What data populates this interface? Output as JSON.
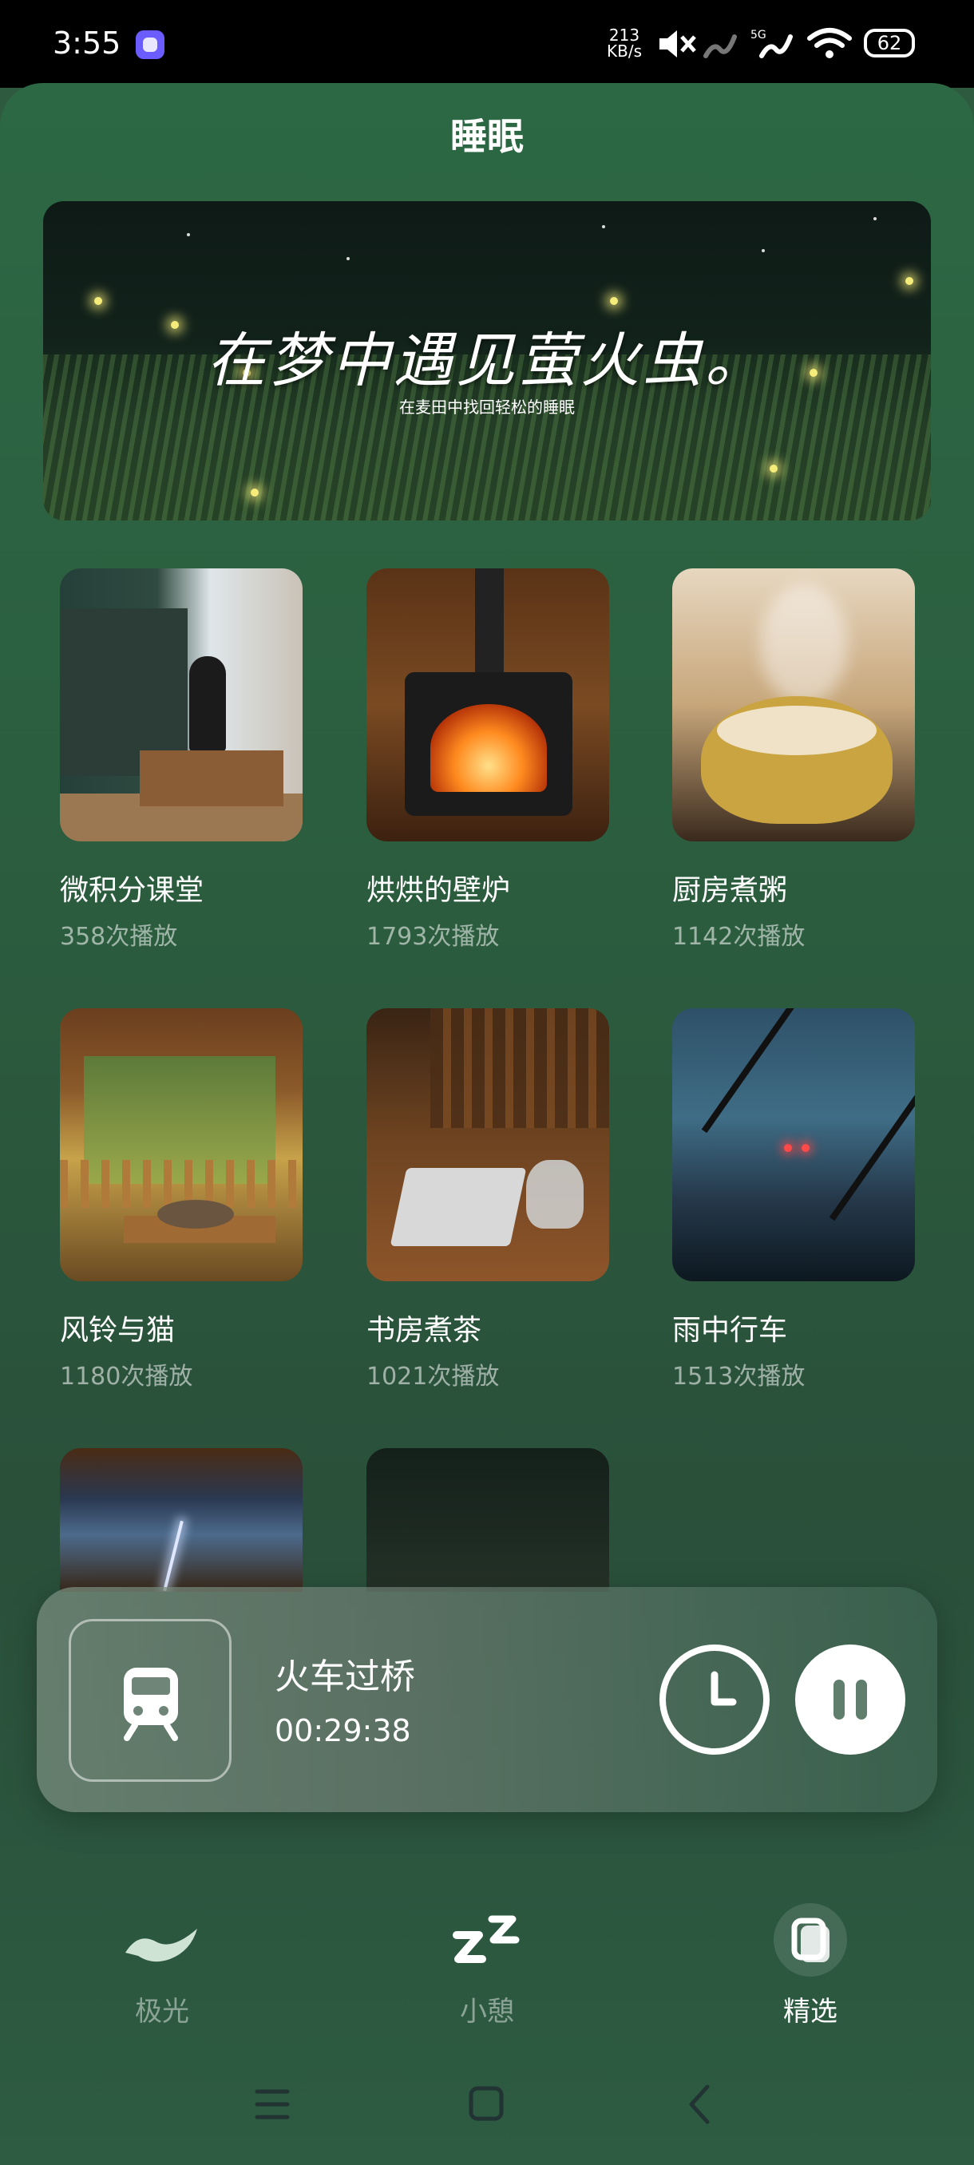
{
  "status_bar": {
    "time": "3:55",
    "net_speed_value": "213",
    "net_speed_unit": "KB/s",
    "network_label": "5G",
    "battery": "62",
    "icons": [
      "app-notification-icon",
      "mute-icon",
      "signal-icon",
      "signal-5g-icon",
      "wifi-icon",
      "battery-icon"
    ]
  },
  "header": {
    "title": "睡眠"
  },
  "banner": {
    "title": "在梦中遇见萤火虫。",
    "subtitle": "在麦田中找回轻松的睡眠"
  },
  "cards": [
    {
      "title": "微积分课堂",
      "plays": "358次播放"
    },
    {
      "title": "烘烘的壁炉",
      "plays": "1793次播放"
    },
    {
      "title": "厨房煮粥",
      "plays": "1142次播放"
    },
    {
      "title": "风铃与猫",
      "plays": "1180次播放"
    },
    {
      "title": "书房煮茶",
      "plays": "1021次播放"
    },
    {
      "title": "雨中行车",
      "plays": "1513次播放"
    }
  ],
  "player": {
    "title": "火车过桥",
    "elapsed": "00:29:38",
    "icons": [
      "train-icon",
      "timer-icon",
      "pause-icon"
    ]
  },
  "bottom_nav": {
    "items": [
      {
        "label": "极光",
        "icon": "aurora-icon",
        "active": false
      },
      {
        "label": "小憩",
        "icon": "zzz-icon",
        "active": false
      },
      {
        "label": "精选",
        "icon": "featured-icon",
        "active": true
      }
    ]
  },
  "system_nav": {
    "icons": [
      "menu-icon",
      "home-icon",
      "back-icon"
    ]
  },
  "colors": {
    "background": "#2e5a40",
    "accent": "#ffffff",
    "dim_text": "#8aa596"
  }
}
